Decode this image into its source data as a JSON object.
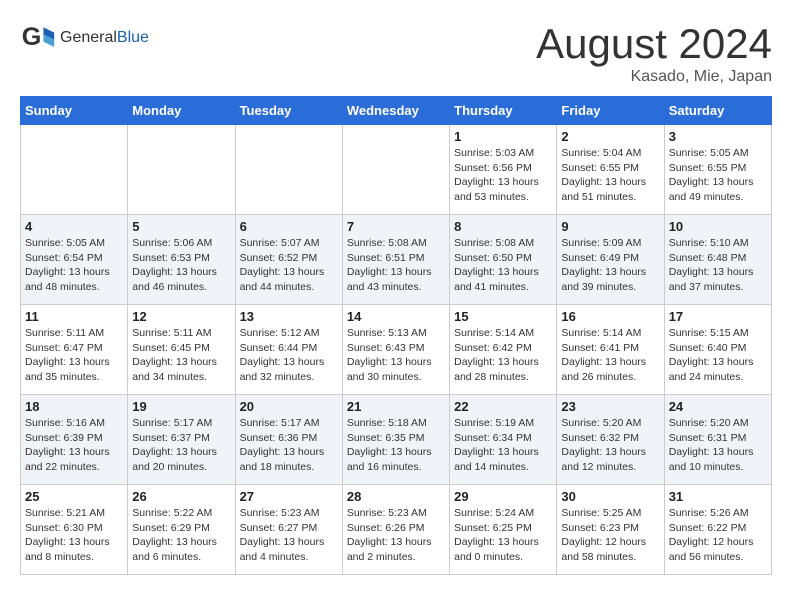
{
  "header": {
    "logo_general": "General",
    "logo_blue": "Blue",
    "title": "August 2024",
    "subtitle": "Kasado, Mie, Japan"
  },
  "weekdays": [
    "Sunday",
    "Monday",
    "Tuesday",
    "Wednesday",
    "Thursday",
    "Friday",
    "Saturday"
  ],
  "weeks": [
    [
      {
        "day": "",
        "info": ""
      },
      {
        "day": "",
        "info": ""
      },
      {
        "day": "",
        "info": ""
      },
      {
        "day": "",
        "info": ""
      },
      {
        "day": "1",
        "info": "Sunrise: 5:03 AM\nSunset: 6:56 PM\nDaylight: 13 hours\nand 53 minutes."
      },
      {
        "day": "2",
        "info": "Sunrise: 5:04 AM\nSunset: 6:55 PM\nDaylight: 13 hours\nand 51 minutes."
      },
      {
        "day": "3",
        "info": "Sunrise: 5:05 AM\nSunset: 6:55 PM\nDaylight: 13 hours\nand 49 minutes."
      }
    ],
    [
      {
        "day": "4",
        "info": "Sunrise: 5:05 AM\nSunset: 6:54 PM\nDaylight: 13 hours\nand 48 minutes."
      },
      {
        "day": "5",
        "info": "Sunrise: 5:06 AM\nSunset: 6:53 PM\nDaylight: 13 hours\nand 46 minutes."
      },
      {
        "day": "6",
        "info": "Sunrise: 5:07 AM\nSunset: 6:52 PM\nDaylight: 13 hours\nand 44 minutes."
      },
      {
        "day": "7",
        "info": "Sunrise: 5:08 AM\nSunset: 6:51 PM\nDaylight: 13 hours\nand 43 minutes."
      },
      {
        "day": "8",
        "info": "Sunrise: 5:08 AM\nSunset: 6:50 PM\nDaylight: 13 hours\nand 41 minutes."
      },
      {
        "day": "9",
        "info": "Sunrise: 5:09 AM\nSunset: 6:49 PM\nDaylight: 13 hours\nand 39 minutes."
      },
      {
        "day": "10",
        "info": "Sunrise: 5:10 AM\nSunset: 6:48 PM\nDaylight: 13 hours\nand 37 minutes."
      }
    ],
    [
      {
        "day": "11",
        "info": "Sunrise: 5:11 AM\nSunset: 6:47 PM\nDaylight: 13 hours\nand 35 minutes."
      },
      {
        "day": "12",
        "info": "Sunrise: 5:11 AM\nSunset: 6:45 PM\nDaylight: 13 hours\nand 34 minutes."
      },
      {
        "day": "13",
        "info": "Sunrise: 5:12 AM\nSunset: 6:44 PM\nDaylight: 13 hours\nand 32 minutes."
      },
      {
        "day": "14",
        "info": "Sunrise: 5:13 AM\nSunset: 6:43 PM\nDaylight: 13 hours\nand 30 minutes."
      },
      {
        "day": "15",
        "info": "Sunrise: 5:14 AM\nSunset: 6:42 PM\nDaylight: 13 hours\nand 28 minutes."
      },
      {
        "day": "16",
        "info": "Sunrise: 5:14 AM\nSunset: 6:41 PM\nDaylight: 13 hours\nand 26 minutes."
      },
      {
        "day": "17",
        "info": "Sunrise: 5:15 AM\nSunset: 6:40 PM\nDaylight: 13 hours\nand 24 minutes."
      }
    ],
    [
      {
        "day": "18",
        "info": "Sunrise: 5:16 AM\nSunset: 6:39 PM\nDaylight: 13 hours\nand 22 minutes."
      },
      {
        "day": "19",
        "info": "Sunrise: 5:17 AM\nSunset: 6:37 PM\nDaylight: 13 hours\nand 20 minutes."
      },
      {
        "day": "20",
        "info": "Sunrise: 5:17 AM\nSunset: 6:36 PM\nDaylight: 13 hours\nand 18 minutes."
      },
      {
        "day": "21",
        "info": "Sunrise: 5:18 AM\nSunset: 6:35 PM\nDaylight: 13 hours\nand 16 minutes."
      },
      {
        "day": "22",
        "info": "Sunrise: 5:19 AM\nSunset: 6:34 PM\nDaylight: 13 hours\nand 14 minutes."
      },
      {
        "day": "23",
        "info": "Sunrise: 5:20 AM\nSunset: 6:32 PM\nDaylight: 13 hours\nand 12 minutes."
      },
      {
        "day": "24",
        "info": "Sunrise: 5:20 AM\nSunset: 6:31 PM\nDaylight: 13 hours\nand 10 minutes."
      }
    ],
    [
      {
        "day": "25",
        "info": "Sunrise: 5:21 AM\nSunset: 6:30 PM\nDaylight: 13 hours\nand 8 minutes."
      },
      {
        "day": "26",
        "info": "Sunrise: 5:22 AM\nSunset: 6:29 PM\nDaylight: 13 hours\nand 6 minutes."
      },
      {
        "day": "27",
        "info": "Sunrise: 5:23 AM\nSunset: 6:27 PM\nDaylight: 13 hours\nand 4 minutes."
      },
      {
        "day": "28",
        "info": "Sunrise: 5:23 AM\nSunset: 6:26 PM\nDaylight: 13 hours\nand 2 minutes."
      },
      {
        "day": "29",
        "info": "Sunrise: 5:24 AM\nSunset: 6:25 PM\nDaylight: 13 hours\nand 0 minutes."
      },
      {
        "day": "30",
        "info": "Sunrise: 5:25 AM\nSunset: 6:23 PM\nDaylight: 12 hours\nand 58 minutes."
      },
      {
        "day": "31",
        "info": "Sunrise: 5:26 AM\nSunset: 6:22 PM\nDaylight: 12 hours\nand 56 minutes."
      }
    ]
  ]
}
